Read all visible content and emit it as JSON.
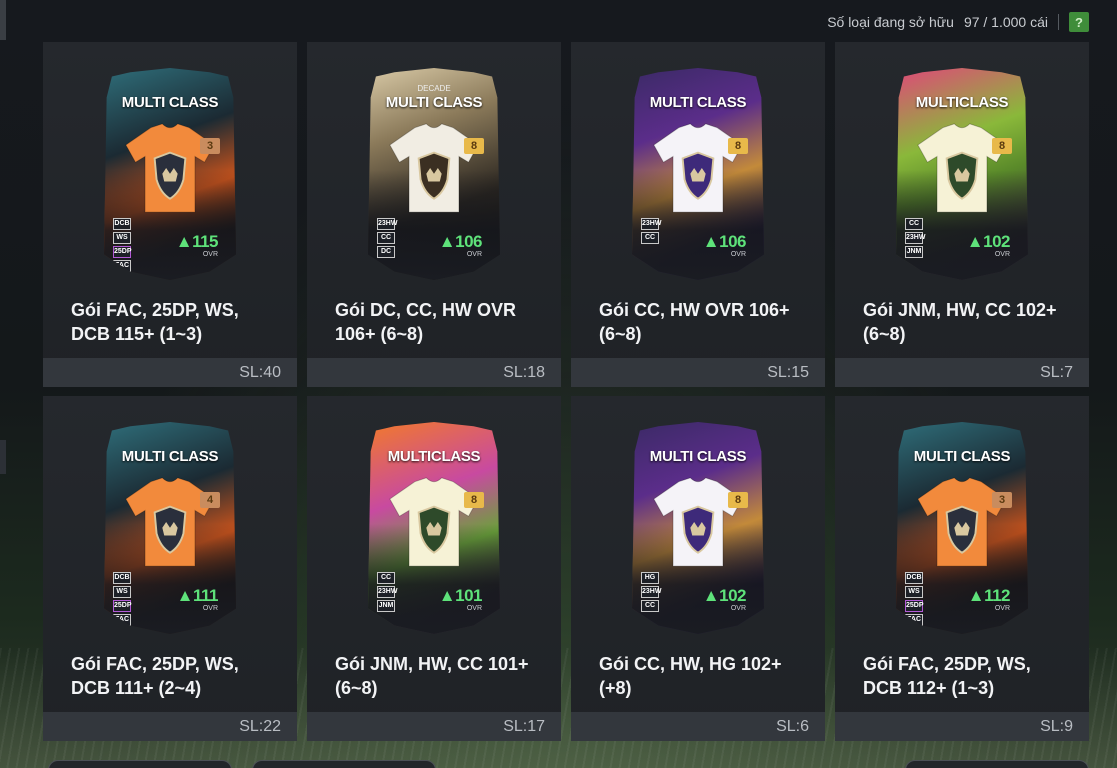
{
  "header": {
    "owned_label": "Số loại đang sở hữu",
    "owned_value": "97 / 1.000 cái",
    "help_label": "?"
  },
  "colors": {
    "ovr_green": "#5ee27a",
    "help_green": "#3f8d3a"
  },
  "packs": [
    {
      "name": "Gói FAC, 25DP, WS, DCB 115+ (1~3)",
      "qty": "SL:40",
      "card_title": "MULTI CLASS",
      "card_subtitle": "",
      "grade": "3",
      "ovr": "115",
      "ovr_label": "OVR",
      "positions": [
        "DCB",
        "WS",
        "25DP",
        "FAC"
      ],
      "theme": "fac"
    },
    {
      "name": "Gói DC, CC, HW OVR 106+ (6~8)",
      "qty": "SL:18",
      "card_title": "MULTI CLASS",
      "card_subtitle": "DECADE",
      "grade": "8",
      "ovr": "106",
      "ovr_label": "OVR",
      "positions": [
        "23HW",
        "CC",
        "DC"
      ],
      "theme": "dc"
    },
    {
      "name": "Gói CC, HW OVR 106+ (6~8)",
      "qty": "SL:15",
      "card_title": "MULTI CLASS",
      "card_subtitle": "",
      "grade": "8",
      "ovr": "106",
      "ovr_label": "OVR",
      "positions": [
        "23HW",
        "CC"
      ],
      "theme": "cc"
    },
    {
      "name": "Gói JNM, HW, CC 102+ (6~8)",
      "qty": "SL:7",
      "card_title": "MULTICLASS",
      "card_subtitle": "",
      "grade": "8",
      "ovr": "102",
      "ovr_label": "OVR",
      "positions": [
        "CC",
        "23HW",
        "JNM"
      ],
      "theme": "jnm"
    },
    {
      "name": "Gói FAC, 25DP, WS, DCB 111+ (2~4)",
      "qty": "SL:22",
      "card_title": "MULTI CLASS",
      "card_subtitle": "",
      "grade": "4",
      "ovr": "111",
      "ovr_label": "OVR",
      "positions": [
        "DCB",
        "WS",
        "25DP",
        "FAC"
      ],
      "theme": "fac"
    },
    {
      "name": "Gói JNM, HW, CC 101+ (6~8)",
      "qty": "SL:17",
      "card_title": "MULTICLASS",
      "card_subtitle": "",
      "grade": "8",
      "ovr": "101",
      "ovr_label": "OVR",
      "positions": [
        "CC",
        "23HW",
        "JNM"
      ],
      "theme": "jnm2"
    },
    {
      "name": "Gói CC, HW, HG 102+ (+8)",
      "qty": "SL:6",
      "card_title": "MULTI CLASS",
      "card_subtitle": "",
      "grade": "8",
      "ovr": "102",
      "ovr_label": "OVR",
      "positions": [
        "HG",
        "23HW",
        "CC"
      ],
      "theme": "cc"
    },
    {
      "name": "Gói FAC, 25DP, WS, DCB 112+ (1~3)",
      "qty": "SL:9",
      "card_title": "MULTI CLASS",
      "card_subtitle": "",
      "grade": "3",
      "ovr": "112",
      "ovr_label": "OVR",
      "positions": [
        "DCB",
        "WS",
        "25DP",
        "FAC"
      ],
      "theme": "fac"
    }
  ]
}
